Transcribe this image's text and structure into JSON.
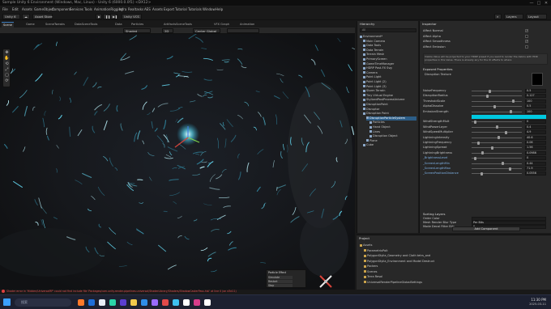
{
  "window": {
    "title": "Sample Unity 6 Environment (Windows, Mac, Linux) - Unity 6 (6000.0.0f1) <DX12>",
    "controls": [
      "—",
      "□",
      "✕"
    ]
  },
  "menu": [
    "File",
    "Edit",
    "Assets",
    "GameObject",
    "Component",
    "Services",
    "Tools",
    "AnimationRigging",
    "Infra",
    "Realtasks",
    "AES",
    "Assets",
    "Export",
    "Tutorial",
    "Tutorials",
    "Window",
    "Help"
  ],
  "toolbar": {
    "account": "Unity 6",
    "cloud": "☁",
    "branch": "Asset Store",
    "play_icons": [
      "▶",
      "❚❚",
      "▶❚"
    ],
    "version_control": "Unity VCS",
    "search_icon": "⌕",
    "layers": "Layers",
    "layout": "Layout"
  },
  "scene_tabs": [
    "Scene",
    "Game",
    "SceneTweaks",
    "DataSceneTools",
    "Data",
    "Particles",
    "ArtifactsSceneTools",
    "VFX Graph",
    "Animation"
  ],
  "scene_toolbar": {
    "left": "Shaded",
    "center": "2D",
    "right": "Center  Global"
  },
  "viewport": {
    "tools": [
      "✥",
      "✋",
      "⟲",
      "⤢",
      "▢",
      "⟳",
      "☰"
    ],
    "overlay": {
      "title": "Particle Effect",
      "rows": [
        "Simulate",
        "Restart",
        "Stop"
      ]
    }
  },
  "hierarchy": {
    "tab": "Hierarchy",
    "search_placeholder": "All",
    "items": [
      {
        "label": "Environment*",
        "indent": 0,
        "selected": false
      },
      {
        "label": "Main Camera",
        "indent": 1,
        "selected": false
      },
      {
        "label": "Data Tools",
        "indent": 1,
        "selected": false
      },
      {
        "label": "Data Terrain",
        "indent": 1,
        "selected": false
      },
      {
        "label": "Terrain Mesh",
        "indent": 1,
        "selected": false
      },
      {
        "label": "PrimaryScreen",
        "indent": 1,
        "selected": false
      },
      {
        "label": "GameTimeManager",
        "indent": 1,
        "selected": false
      },
      {
        "label": "HDRP Post-FX Svg",
        "indent": 1,
        "selected": false
      },
      {
        "label": "Camera",
        "indent": 1,
        "selected": false
      },
      {
        "label": "Point Light",
        "indent": 1,
        "selected": false
      },
      {
        "label": "Point Light (2)",
        "indent": 1,
        "selected": false
      },
      {
        "label": "Point Light (3)",
        "indent": 1,
        "selected": false
      },
      {
        "label": "Storm Terrain",
        "indent": 1,
        "selected": false
      },
      {
        "label": "Tiny Virtual Engine",
        "indent": 1,
        "selected": false
      },
      {
        "label": "StylizedPostProcessVolume",
        "indent": 1,
        "selected": false
      },
      {
        "label": "DisruptionPoint",
        "indent": 1,
        "selected": false
      },
      {
        "label": "Disruptor",
        "indent": 1,
        "selected": false
      },
      {
        "label": "Disruption Point",
        "indent": 1,
        "selected": false
      },
      {
        "label": "DisruptionParticleSystem",
        "indent": 2,
        "selected": true
      },
      {
        "label": "Particles",
        "indent": 3,
        "selected": false
      },
      {
        "label": "Hand Object",
        "indent": 3,
        "selected": false
      },
      {
        "label": "Lines",
        "indent": 3,
        "selected": false
      },
      {
        "label": "Disruption Object",
        "indent": 3,
        "selected": false
      },
      {
        "label": "Plane",
        "indent": 2,
        "selected": false
      },
      {
        "label": "Cube",
        "indent": 1,
        "selected": false
      }
    ]
  },
  "inspector": {
    "tab": "Inspector",
    "toggles": [
      {
        "label": "Affect Normal",
        "checked": true
      },
      {
        "label": "Affect Alpha",
        "checked": false
      },
      {
        "label": "Affect Smoothness",
        "checked": true
      },
      {
        "label": "Affect Emission",
        "checked": false
      }
    ],
    "info_text": "Visible Value will be projected to your HDRP preset if you want to render the debris with HDR properties in this Value. There is already any for the UI affects to where",
    "section": "Exposed Properties",
    "subsection": "Disruption Texture",
    "properties": [
      {
        "label": "NoiseFrequency",
        "value": "0.5",
        "level": 0.35
      },
      {
        "label": "DisruptionRadius",
        "value": "0.127",
        "level": 0.3
      },
      {
        "label": "ThresholdScale",
        "value": "100",
        "level": 0.85
      },
      {
        "label": "AlphaDissolve",
        "value": "0.5",
        "level": 0.45
      },
      {
        "label": "EmissionStrength",
        "value": "100",
        "level": 0.8
      },
      {
        "label": "WindStrengthMult",
        "value": "0",
        "level": 0.05
      },
      {
        "label": "WindPowerLayer",
        "value": "0.4",
        "level": 0.5
      },
      {
        "label": "WindSpeedMultiplier",
        "value": "4.9",
        "level": 0.7
      },
      {
        "label": "LightningIntensity",
        "value": "40.6",
        "level": 0.55
      },
      {
        "label": "LightningFrequency",
        "value": "0.06",
        "level": 0.12
      },
      {
        "label": "LightningSpread",
        "value": "1.56",
        "level": 0.4
      },
      {
        "label": "LightningBrightness",
        "value": "0.0986",
        "level": 0.2
      },
      {
        "label": "_BrightnessLevel",
        "value": "0",
        "level": 0.05
      },
      {
        "label": "_ScreenLengthMin",
        "value": "0.44",
        "level": 0.62
      },
      {
        "label": "_ScreenLengthMax",
        "value": "71.9",
        "level": 0.78
      },
      {
        "label": "_ScreenPositionDistance",
        "value": "0.0556",
        "level": 0.18
      }
    ],
    "color_swatch": "#00c8e0",
    "sorting": {
      "title": "Sorting Layers",
      "rows": [
        {
          "label": "Order Color",
          "value": ""
        },
        {
          "label": "Mesh Render Blur Type",
          "value": "Per Bits"
        },
        {
          "label": "Mode Decal Filter Bits",
          "value": "0"
        }
      ]
    },
    "add_component": "Add Component"
  },
  "project": {
    "tab": "Project",
    "tree": [
      {
        "label": "Assets",
        "indent": 0
      },
      {
        "label": "ParametrixPolt",
        "indent": 1
      },
      {
        "label": "PolygonStylia_Geometry and Cloth tetrs_and",
        "indent": 1
      },
      {
        "label": "PolygonStylia_Environment and Model Destruct",
        "indent": 1
      },
      {
        "label": "Packers",
        "indent": 1
      },
      {
        "label": "Scenes",
        "indent": 1
      },
      {
        "label": "Terra Resol",
        "indent": 1
      },
      {
        "label": "UniversalRenderPipelineGlobalSettings",
        "indent": 1
      }
    ]
  },
  "console": {
    "error": "Shader error in 'Hidden/UniversalRP' could not find include file 'Packages/com.unity.render-pipelines.universal/ShaderLibrary/Shaders/ShadowCasterPass.hlsl' at line 0 (on d3d11)"
  },
  "taskbar": {
    "search_placeholder": "搜索",
    "time": "11:30 PM",
    "date": "2025-03-11",
    "app_colors": [
      "#ff7a2a",
      "#1e6fd9",
      "#e8eef8",
      "#2ad4a8",
      "#5b3fd0",
      "#f2c94c",
      "#2f8ee8",
      "#9b6bff",
      "#e14a4a",
      "#3ec1f0",
      "#ffffff",
      "#d73c8a",
      "#ffffff"
    ]
  }
}
